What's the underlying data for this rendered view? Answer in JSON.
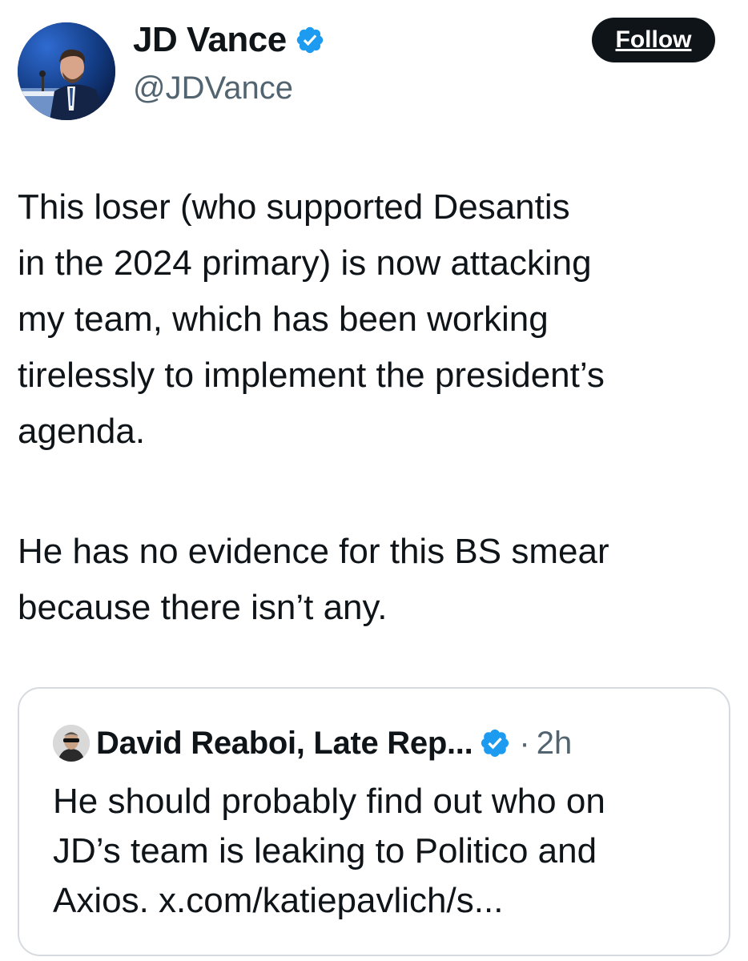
{
  "author": {
    "display_name": "JD Vance",
    "handle": "@JDVance",
    "verified": true,
    "badge_color": "#1d9bf0"
  },
  "follow_button": {
    "label": "Follow"
  },
  "tweet": {
    "lines": [
      "This loser (who supported Desantis",
      "in the 2024 primary) is now attacking",
      "my team, which has been working",
      "tirelessly to implement the president’s",
      "agenda."
    ],
    "lines2": [
      "He has no evidence for this BS smear",
      "because there isn’t any."
    ]
  },
  "quoted_tweet": {
    "display_name": "David Reaboi, Late Rep...",
    "verified": true,
    "separator": "·",
    "time": "2h",
    "lines": [
      "He should probably find out who on",
      "JD’s team is leaking to Politico and",
      "Axios. x.com/katiepavlich/s..."
    ]
  },
  "icons": {
    "author_avatar": "profile-photo",
    "verified": "verified-badge-icon",
    "quote_avatar": "profile-photo"
  }
}
